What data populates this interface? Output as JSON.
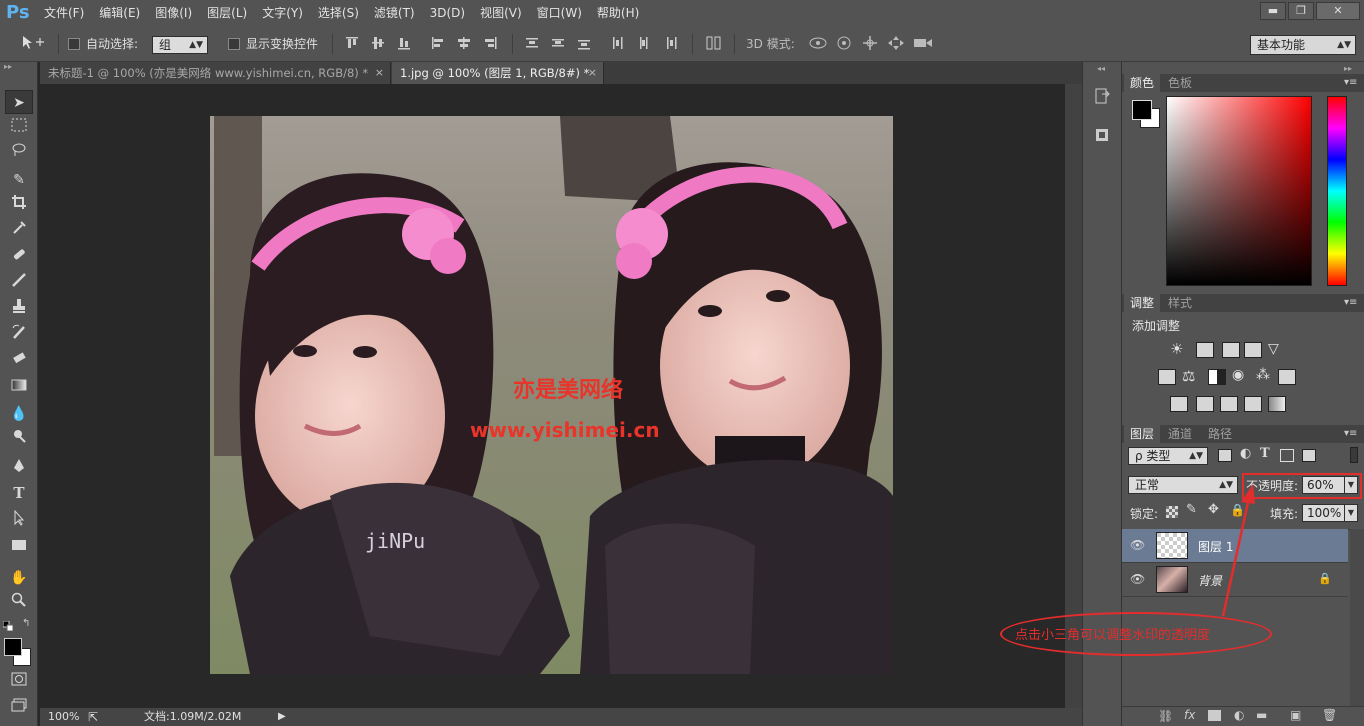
{
  "app": {
    "logo": "Ps"
  },
  "menu": [
    "文件(F)",
    "编辑(E)",
    "图像(I)",
    "图层(L)",
    "文字(Y)",
    "选择(S)",
    "滤镜(T)",
    "3D(D)",
    "视图(V)",
    "窗口(W)",
    "帮助(H)"
  ],
  "window_controls": {
    "minimize": "▬",
    "restore": "❐",
    "close": "✕"
  },
  "options_bar": {
    "tool_icon": "move-tool-icon",
    "auto_select_label": "自动选择:",
    "auto_select_value": "组",
    "show_transform_label": "显示变换控件",
    "mode_3d_label": "3D 模式:",
    "workspace_value": "基本功能"
  },
  "doc_tabs": [
    {
      "label": "未标题-1 @ 100% (亦是美网络 www.yishimei.cn, RGB/8) *",
      "close": "×"
    },
    {
      "label": "1.jpg @ 100% (图层 1, RGB/8#) *",
      "close": "×"
    }
  ],
  "canvas": {
    "watermark_line1": "亦是美网络",
    "watermark_line2": "www.yishimei.cn",
    "shirt_text": "jiNPu"
  },
  "status": {
    "zoom": "100%",
    "doc_info": "文档:1.09M/2.02M"
  },
  "color_panel": {
    "tabs": [
      "颜色",
      "色板"
    ],
    "fg": "#000000",
    "bg": "#ffffff"
  },
  "adjust_panel": {
    "tabs": [
      "调整",
      "样式"
    ],
    "title": "添加调整"
  },
  "layers_panel": {
    "tabs": [
      "图层",
      "通道",
      "路径"
    ],
    "filter_label": "ρ 类型",
    "blend_mode": "正常",
    "opacity_label": "不透明度:",
    "opacity_value": "60%",
    "lock_label": "锁定:",
    "fill_label": "填充:",
    "fill_value": "100%",
    "layers": [
      {
        "name": "图层 1",
        "selected": true
      },
      {
        "name": "背景",
        "selected": false
      }
    ]
  },
  "annotation": "点击小三角可以调整水印的透明度",
  "colors": {
    "accent_red": "#e32d2d",
    "selected_layer": "#6a7b93",
    "panel_bg": "#535353"
  }
}
